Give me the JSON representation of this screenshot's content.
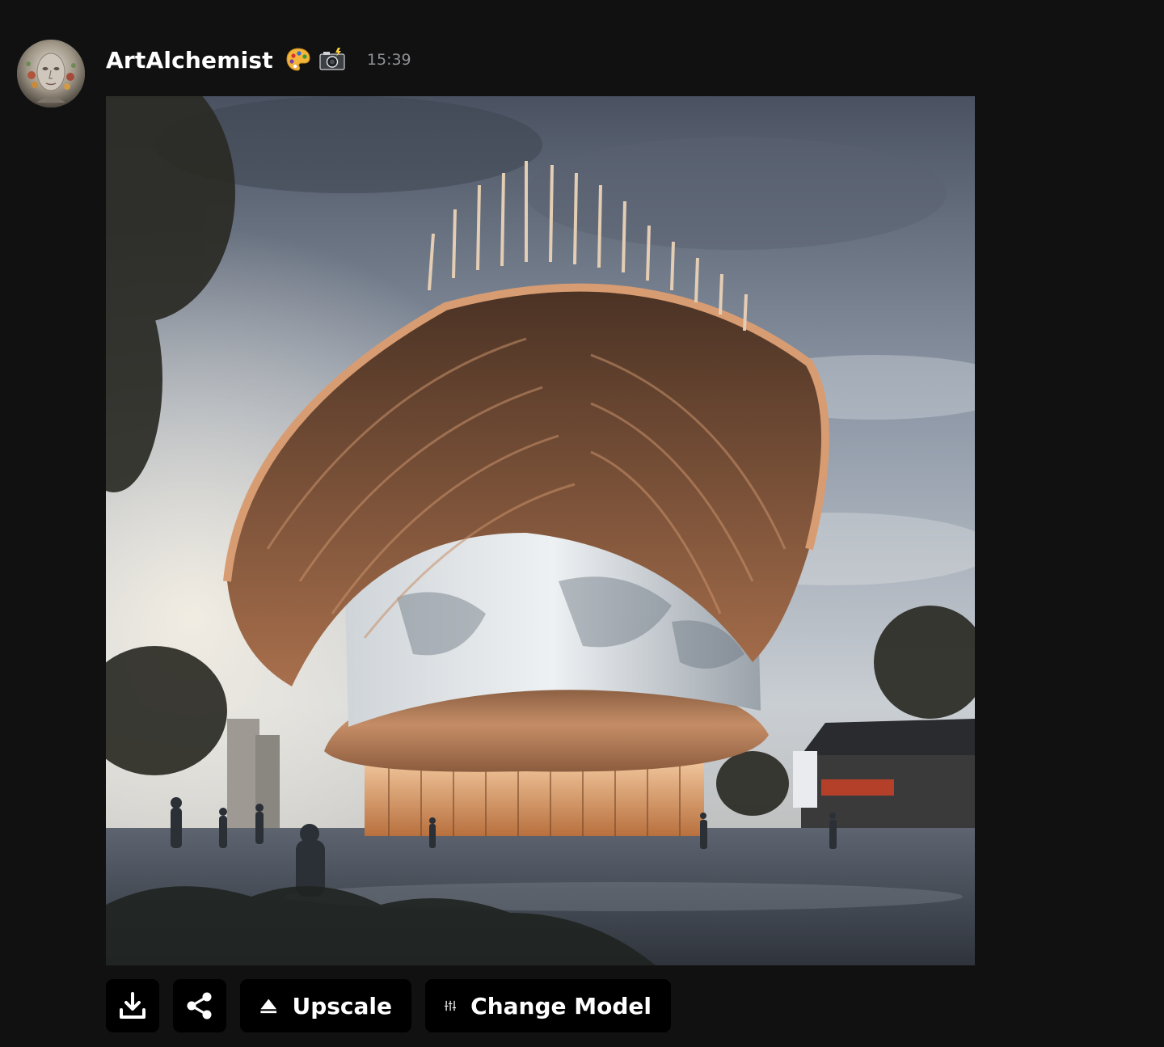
{
  "message": {
    "author": "ArtAlchemist",
    "author_emojis": [
      "artist-palette",
      "camera-with-flash"
    ],
    "timestamp": "15:39"
  },
  "image": {
    "subject": "architectural-render"
  },
  "actions": {
    "download_icon": "download-icon",
    "share_icon": "share-icon",
    "upscale_label": "Upscale",
    "upscale_icon": "eject-triangle-icon",
    "change_model_label": "Change Model",
    "change_model_icon": "sliders-icon"
  },
  "colors": {
    "background": "#111111",
    "button_bg": "#000000",
    "text": "#ffffff",
    "timestamp": "#8f9195"
  }
}
